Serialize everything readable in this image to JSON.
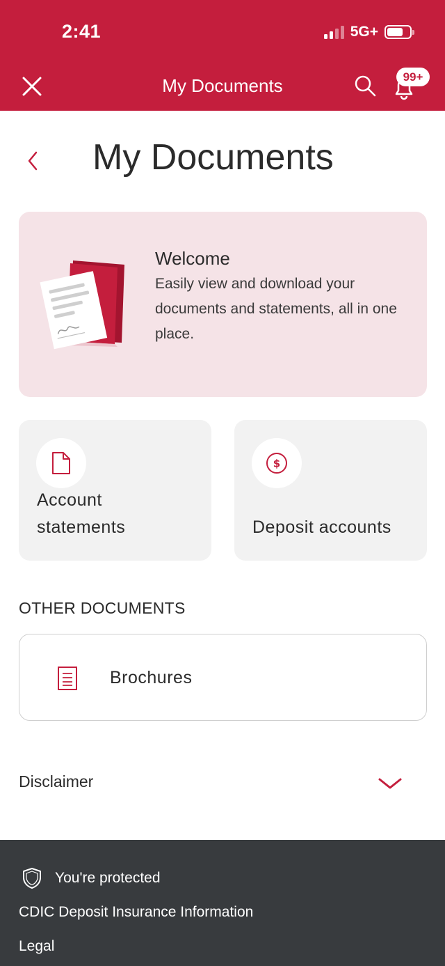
{
  "status_bar": {
    "time": "2:41",
    "network": "5G+"
  },
  "nav": {
    "title": "My Documents",
    "notification_badge": "99+"
  },
  "page": {
    "title": "My Documents"
  },
  "welcome": {
    "title": "Welcome",
    "text": "Easily view and download your documents and statements, all in one place."
  },
  "tiles": [
    {
      "label": "Account statements",
      "icon": "document-icon"
    },
    {
      "label": "Deposit accounts",
      "icon": "dollar-circle-icon"
    }
  ],
  "other_documents": {
    "heading": "OTHER DOCUMENTS",
    "items": [
      {
        "label": "Brochures",
        "icon": "list-document-icon"
      }
    ]
  },
  "disclaimer": {
    "label": "Disclaimer"
  },
  "footer": {
    "protected": "You're protected",
    "cdic": "CDIC Deposit Insurance Information",
    "legal": "Legal"
  },
  "colors": {
    "brand_red": "#c41e3d",
    "welcome_bg": "#f5e3e7",
    "tile_bg": "#f2f2f2",
    "footer_bg": "#383b3e"
  }
}
